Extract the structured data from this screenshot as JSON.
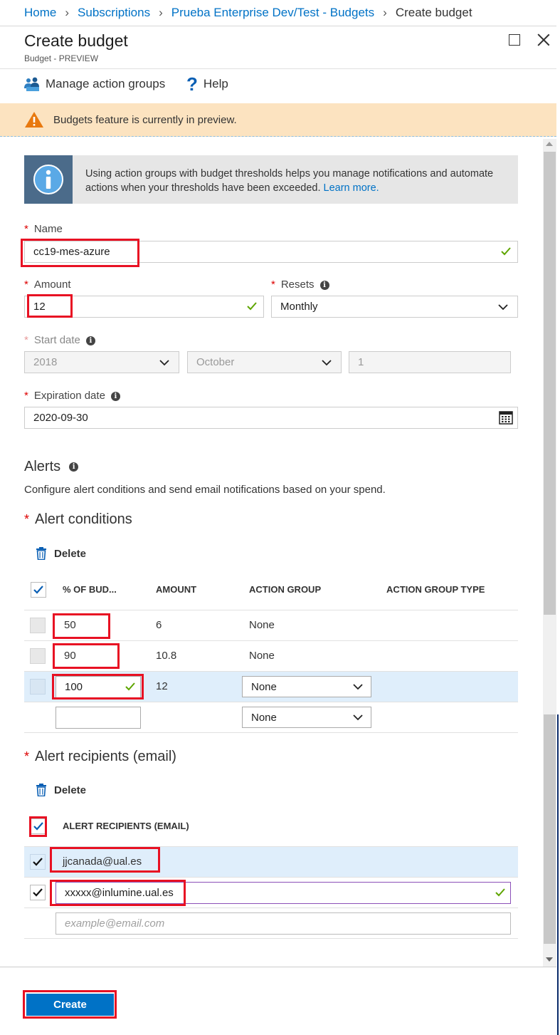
{
  "breadcrumb": [
    {
      "label": "Home"
    },
    {
      "label": "Subscriptions"
    },
    {
      "label": "Prueba Enterprise Dev/Test - Budgets"
    },
    {
      "label": "Create budget"
    }
  ],
  "header": {
    "title": "Create budget",
    "subtitle": "Budget - PREVIEW"
  },
  "commands": {
    "manage_action_groups": "Manage action groups",
    "help": "Help"
  },
  "banner": {
    "text": "Budgets feature is currently in preview."
  },
  "info": {
    "text": "Using action groups with budget thresholds helps you manage notifications and automate actions when your thresholds have been exceeded.",
    "link": "Learn more."
  },
  "form": {
    "name_label": "Name",
    "name_value": "cc19-mes-azure",
    "amount_label": "Amount",
    "amount_value": "12",
    "resets_label": "Resets",
    "resets_value": "Monthly",
    "start_date_label": "Start date",
    "start_year": "2018",
    "start_month": "October",
    "start_day": "1",
    "expiration_label": "Expiration date",
    "expiration_value": "2020-09-30"
  },
  "alerts": {
    "title": "Alerts",
    "description": "Configure alert conditions and send email notifications based on your spend.",
    "conditions_title": "Alert conditions",
    "delete_label": "Delete",
    "columns": [
      "% OF BUD...",
      "AMOUNT",
      "ACTION GROUP",
      "ACTION GROUP TYPE"
    ],
    "rows": [
      {
        "percent": "50",
        "amount": "6",
        "action_group": "None"
      },
      {
        "percent": "90",
        "amount": "10.8",
        "action_group": "None"
      },
      {
        "percent": "100",
        "amount": "12",
        "action_group": "None"
      },
      {
        "percent": "",
        "amount": "",
        "action_group": "None"
      }
    ],
    "recipients_title": "Alert recipients (email)",
    "recipients_delete_label": "Delete",
    "recipients_header": "ALERT RECIPIENTS (EMAIL)",
    "recipients": [
      "jjcanada@ual.es",
      "xxxxx@inlumine.ual.es"
    ],
    "recipient_placeholder": "example@email.com"
  },
  "footer": {
    "create_label": "Create"
  },
  "colors": {
    "accent": "#0072c6",
    "highlight": "#e81123",
    "banner_bg": "#fce3c0",
    "selected_row": "#dfeefb",
    "valid_check": "#5ea500"
  }
}
